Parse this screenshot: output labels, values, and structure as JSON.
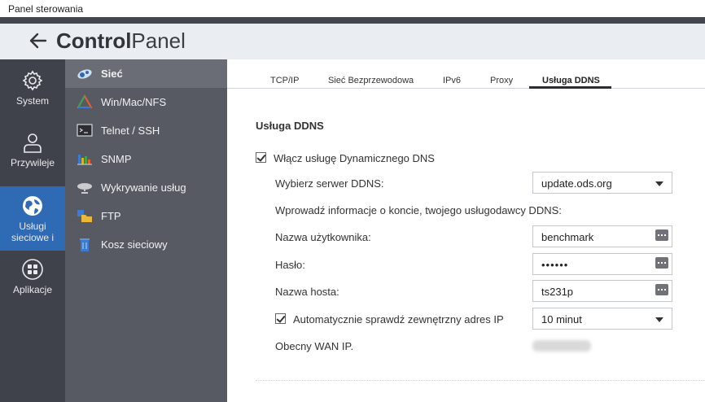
{
  "window": {
    "title": "Panel sterowania"
  },
  "header": {
    "brand_bold": "Control",
    "brand_thin": "Panel"
  },
  "rail": [
    {
      "label": "System",
      "icon": "gear-icon"
    },
    {
      "label": "Przywileje",
      "icon": "user-icon"
    },
    {
      "label": "Usługi sieciowe i",
      "icon": "globe-icon",
      "active": true
    },
    {
      "label": "Aplikacje",
      "icon": "apps-icon"
    }
  ],
  "submenu": [
    {
      "label": "Sieć",
      "icon": "network-icon",
      "active": true
    },
    {
      "label": "Win/Mac/NFS",
      "icon": "win-mac-nfs-icon"
    },
    {
      "label": "Telnet / SSH",
      "icon": "terminal-icon"
    },
    {
      "label": "SNMP",
      "icon": "snmp-chart-icon"
    },
    {
      "label": "Wykrywanie usług",
      "icon": "satellite-dish-icon"
    },
    {
      "label": "FTP",
      "icon": "ftp-folder-icon"
    },
    {
      "label": "Kosz sieciowy",
      "icon": "recycle-bin-icon"
    }
  ],
  "tabs": [
    {
      "label": "TCP/IP"
    },
    {
      "label": "Sieć Bezprzewodowa"
    },
    {
      "label": "IPv6"
    },
    {
      "label": "Proxy"
    },
    {
      "label": "Usługa DDNS",
      "active": true
    }
  ],
  "ddns": {
    "section_title": "Usługa DDNS",
    "enable_label": "Włącz usługę Dynamicznego DNS",
    "enable_checked": true,
    "server_label": "Wybierz serwer DDNS:",
    "server_value": "update.ods.org",
    "info_text": "Wprowadź informacje o koncie, twojego usługodawcy DDNS:",
    "username_label": "Nazwa użytkownika:",
    "username_value": "benchmark",
    "password_label": "Hasło:",
    "password_value": "••••••",
    "hostname_label": "Nazwa hosta:",
    "hostname_value": "ts231p",
    "auto_check_label": "Automatycznie sprawdź zewnętrzny adres IP",
    "auto_check_checked": true,
    "interval_value": "10 minut",
    "wan_label": "Obecny WAN IP."
  }
}
